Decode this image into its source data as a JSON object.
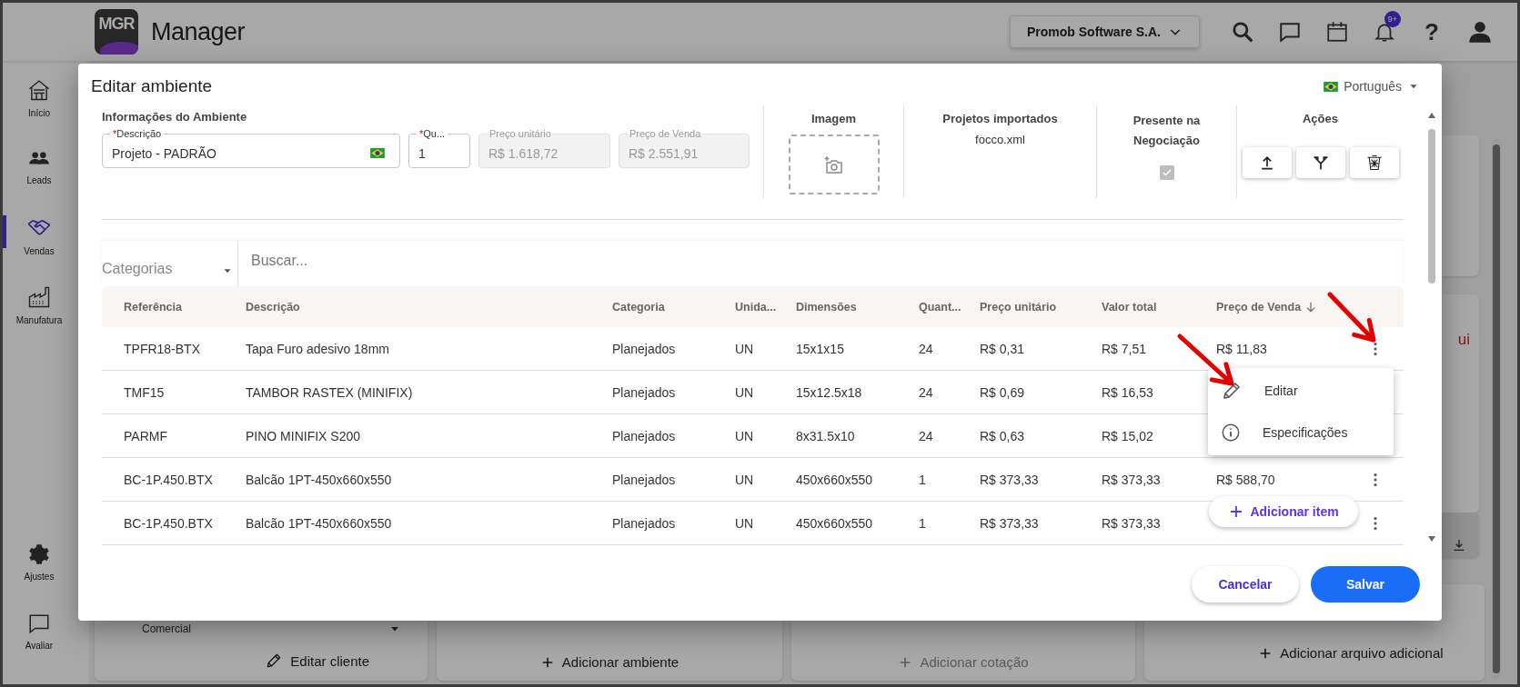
{
  "app": {
    "logo": "MGR",
    "title": "Manager",
    "company": "Promob Software S.A.",
    "notification_badge": "9+",
    "help": "?"
  },
  "sidebar": {
    "items": [
      {
        "label": "Início",
        "kind": "home",
        "selected": false
      },
      {
        "label": "Leads",
        "kind": "people",
        "selected": false
      },
      {
        "label": "Vendas",
        "kind": "handshake",
        "selected": true
      },
      {
        "label": "Manufatura",
        "kind": "factory",
        "selected": false
      }
    ],
    "bottom_items": [
      {
        "label": "Ajustes",
        "kind": "gear",
        "selected": false
      },
      {
        "label": "Avaliar",
        "kind": "chat",
        "selected": false
      }
    ]
  },
  "background": {
    "note_fragment": "ui",
    "client_field": "Comercial",
    "actions": [
      {
        "label": "Editar cliente",
        "kind": "edit",
        "disabled": false
      },
      {
        "label": "Adicionar ambiente",
        "kind": "add",
        "disabled": false
      },
      {
        "label": "Adicionar cotação",
        "kind": "add",
        "disabled": true
      },
      {
        "label": "Adicionar arquivo adicional",
        "kind": "add",
        "disabled": false
      }
    ]
  },
  "dialog": {
    "title": "Editar ambiente",
    "language": "Português",
    "section_title": "Informações do Ambiente",
    "required_marker": "*",
    "fields": [
      {
        "label": "Descrição",
        "value": "Projeto - PADRÃO",
        "required": true,
        "disabled": false,
        "flag": true
      },
      {
        "label": "Qu...",
        "value": "1",
        "required": true,
        "disabled": false,
        "flag": false
      },
      {
        "label": "Preço unitário",
        "value": "R$ 1.618,72",
        "required": false,
        "disabled": true,
        "flag": false
      },
      {
        "label": "Preço de Venda",
        "value": "R$ 2.551,91",
        "required": false,
        "disabled": true,
        "flag": false
      }
    ],
    "image": {
      "header": "Imagem"
    },
    "imported": {
      "header": "Projetos importados",
      "file": "focco.xml"
    },
    "present": {
      "header": "Presente na Negociação",
      "checked": true,
      "disabled": true
    },
    "actions": {
      "header": "Ações",
      "buttons": [
        {
          "kind": "upload"
        },
        {
          "kind": "merge"
        },
        {
          "kind": "trash"
        }
      ]
    },
    "filter": {
      "category_placeholder": "Categorias",
      "search_placeholder": "Buscar..."
    },
    "table": {
      "columns": [
        {
          "label": "Referência",
          "sorted": false
        },
        {
          "label": "Descrição",
          "sorted": false
        },
        {
          "label": "Categoria",
          "sorted": false
        },
        {
          "label": "Unida...",
          "sorted": false
        },
        {
          "label": "Dimensões",
          "sorted": false
        },
        {
          "label": "Quant...",
          "sorted": false
        },
        {
          "label": "Preço unitário",
          "sorted": false
        },
        {
          "label": "Valor total",
          "sorted": false
        },
        {
          "label": "Preço de Venda",
          "sorted": true
        }
      ],
      "rows": [
        {
          "cells": [
            "TPFR18-BTX",
            "Tapa Furo adesivo 18mm",
            "Planejados",
            "UN",
            "15x1x15",
            "24",
            "R$ 0,31",
            "R$ 7,51",
            "R$ 11,83"
          ],
          "menu_open": true
        },
        {
          "cells": [
            "TMF15",
            "TAMBOR RASTEX (MINIFIX)",
            "Planejados",
            "UN",
            "15x12.5x18",
            "24",
            "R$ 0,69",
            "R$ 16,53"
          ],
          "menu_open": false
        },
        {
          "cells": [
            "PARMF",
            "PINO MINIFIX S200",
            "Planejados",
            "UN",
            "8x31.5x10",
            "24",
            "R$ 0,63",
            "R$ 15,02"
          ],
          "menu_open": false
        },
        {
          "cells": [
            "BC-1P.450.BTX",
            "Balcão 1PT-450x660x550",
            "Planejados",
            "UN",
            "450x660x550",
            "1",
            "R$ 373,33",
            "R$ 373,33",
            "R$ 588,70"
          ],
          "menu_open": false
        },
        {
          "cells": [
            "BC-1P.450.BTX",
            "Balcão 1PT-450x660x550",
            "Planejados",
            "UN",
            "450x660x550",
            "1",
            "R$ 373,33",
            "R$ 373,33"
          ],
          "menu_open": false
        }
      ]
    },
    "row_menu": {
      "items": [
        {
          "label": "Editar",
          "kind": "edit"
        },
        {
          "label": "Especificações",
          "kind": "info"
        }
      ]
    },
    "add_item": "Adicionar item",
    "buttons": [
      {
        "label": "Cancelar",
        "kind": "secondary"
      },
      {
        "label": "Salvar",
        "kind": "primary"
      }
    ]
  }
}
